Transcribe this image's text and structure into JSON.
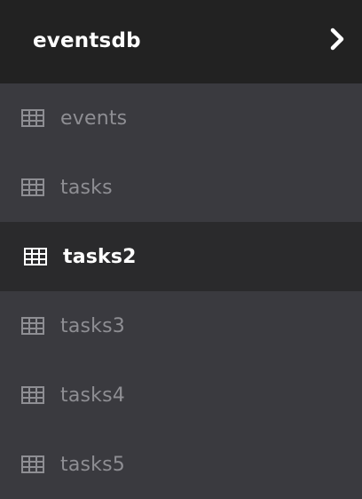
{
  "header": {
    "title": "eventsdb",
    "expand_icon": "chevron-right-icon"
  },
  "tables": {
    "items": [
      {
        "label": "events",
        "icon": "table-icon",
        "active": false
      },
      {
        "label": "tasks",
        "icon": "table-icon",
        "active": false
      },
      {
        "label": "tasks2",
        "icon": "table-icon",
        "active": true
      },
      {
        "label": "tasks3",
        "icon": "table-icon",
        "active": false
      },
      {
        "label": "tasks4",
        "icon": "table-icon",
        "active": false
      },
      {
        "label": "tasks5",
        "icon": "table-icon",
        "active": false
      }
    ]
  },
  "colors": {
    "header_bg": "#222222",
    "panel_bg": "#3a3a3f",
    "active_bg": "#2a2a2c",
    "inactive_text": "#8e8e93",
    "active_text": "#ffffff"
  }
}
